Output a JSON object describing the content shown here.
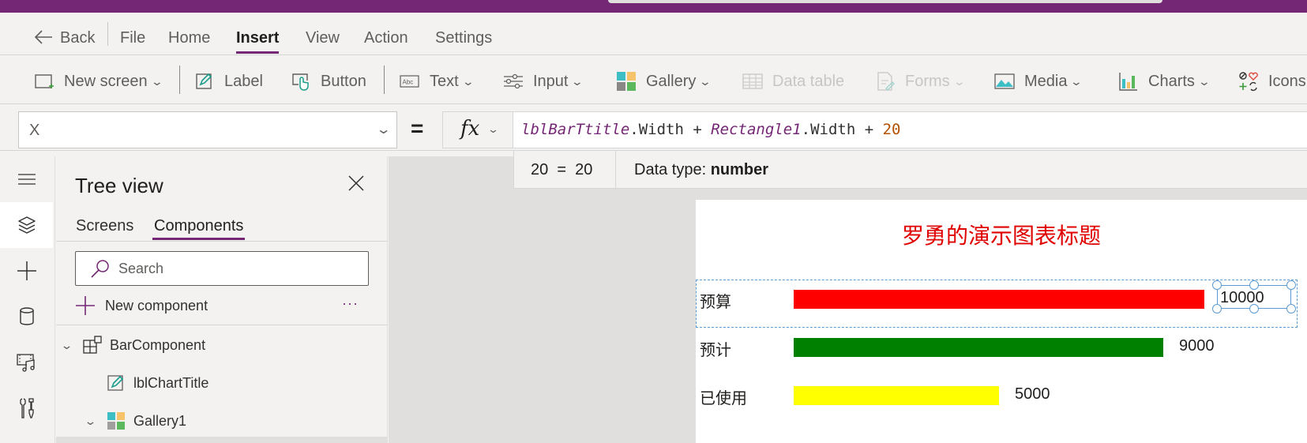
{
  "menu": {
    "back": "Back",
    "items": [
      "File",
      "Home",
      "Insert",
      "View",
      "Action",
      "Settings"
    ],
    "active": "Insert"
  },
  "ribbon": {
    "new_screen": "New screen",
    "label": "Label",
    "button": "Button",
    "text": "Text",
    "input": "Input",
    "gallery": "Gallery",
    "data_table": "Data table",
    "forms": "Forms",
    "media": "Media",
    "charts": "Charts",
    "icons": "Icons"
  },
  "formula_bar": {
    "property": "X",
    "equals": "=",
    "fx": "fx",
    "formula_tokens": [
      {
        "type": "id",
        "text": "lblBarTtitle"
      },
      {
        "type": "op",
        "text": ".Width + "
      },
      {
        "type": "id",
        "text": "Rectangle1"
      },
      {
        "type": "op",
        "text": ".Width + "
      },
      {
        "type": "num",
        "text": "20"
      }
    ],
    "result": "20  =  20",
    "data_type_label": "Data type: ",
    "data_type_value": "number"
  },
  "tree_view": {
    "title": "Tree view",
    "tabs": [
      "Screens",
      "Components"
    ],
    "active_tab": "Components",
    "search_placeholder": "Search",
    "new_component": "New component",
    "more": "···",
    "nodes": [
      {
        "name": "BarComponent",
        "level": 0,
        "expanded": true,
        "icon": "component-icon"
      },
      {
        "name": "lblChartTitle",
        "level": 1,
        "icon": "label-icon"
      },
      {
        "name": "Gallery1",
        "level": 1,
        "expanded": true,
        "icon": "gallery-icon"
      }
    ]
  },
  "canvas": {
    "chart_title": "罗勇的演示图表标题",
    "bars": [
      {
        "label": "预算",
        "value": 10000,
        "value_text": "10000",
        "color": "#ff0000"
      },
      {
        "label": "预计",
        "value": 9000,
        "value_text": "9000",
        "color": "#008000"
      },
      {
        "label": "已使用",
        "value": 5000,
        "value_text": "5000",
        "color": "#ffff00"
      }
    ],
    "max_value": 10000
  },
  "colors": {
    "brand": "#742774",
    "title_red": "#e00000",
    "selection": "#5a9bd5"
  }
}
